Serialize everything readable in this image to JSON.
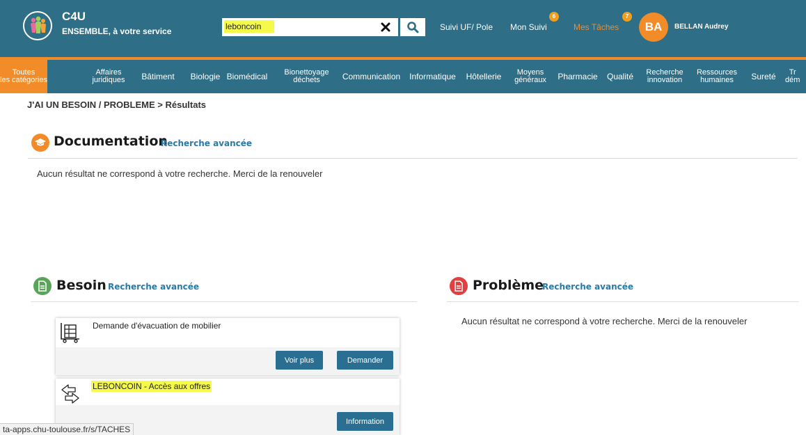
{
  "header": {
    "brand_title": "C4U",
    "brand_subtitle": "ENSEMBLE, à votre service",
    "search_value": "leboncoin",
    "links": {
      "suivi_uf": "Suivi UF/ Pole",
      "mon_suivi": "Mon Suivi",
      "mon_suivi_count": "6",
      "mes_taches": "Mes Tâches",
      "mes_taches_count": "7"
    },
    "user": {
      "initials": "BA",
      "name": "BELLAN Audrey"
    },
    "colors": {
      "header_bg": "#2e6e86",
      "accent": "#f28c28",
      "search_highlight": "#f4f94a"
    }
  },
  "categories": [
    {
      "line1": "Toutes",
      "line2": "les catégories"
    },
    {
      "line1": "Affaires",
      "line2": "juridiques"
    },
    {
      "line1": "Bâtiment",
      "line2": ""
    },
    {
      "line1": "Biologie",
      "line2": ""
    },
    {
      "line1": "Biomédical",
      "line2": ""
    },
    {
      "line1": "Bionettoyage",
      "line2": "déchets"
    },
    {
      "line1": "Communication",
      "line2": ""
    },
    {
      "line1": "Informatique",
      "line2": ""
    },
    {
      "line1": "Hôtellerie",
      "line2": ""
    },
    {
      "line1": "Moyens",
      "line2": "généraux"
    },
    {
      "line1": "Pharmacie",
      "line2": ""
    },
    {
      "line1": "Qualité",
      "line2": ""
    },
    {
      "line1": "Recherche",
      "line2": "innovation"
    },
    {
      "line1": "Ressources",
      "line2": "humaines"
    },
    {
      "line1": "Sureté",
      "line2": ""
    },
    {
      "line1": "Tr",
      "line2": "dém"
    }
  ],
  "breadcrumb": "J'AI UN BESOIN / PROBLEME > Résultats",
  "documentation": {
    "title": "Documentation",
    "advanced_link": "Recherche avancée",
    "no_result": "Aucun résultat ne correspond à votre recherche. Merci de la renouveler"
  },
  "besoin": {
    "title": "Besoin",
    "advanced_link": "Recherche avancée",
    "cards": [
      {
        "title": "Demande d'évacuation de mobilier",
        "buttons": [
          "Voir plus",
          "Demander"
        ]
      },
      {
        "title": "LEBONCOIN - Accès aux offres",
        "buttons": [
          "Information"
        ]
      }
    ]
  },
  "probleme": {
    "title": "Problème",
    "advanced_link": "Recherche avancée",
    "no_result": "Aucun résultat ne correspond à votre recherche. Merci de la renouveler"
  },
  "status_bar": "ta-apps.chu-toulouse.fr/s/TACHES"
}
